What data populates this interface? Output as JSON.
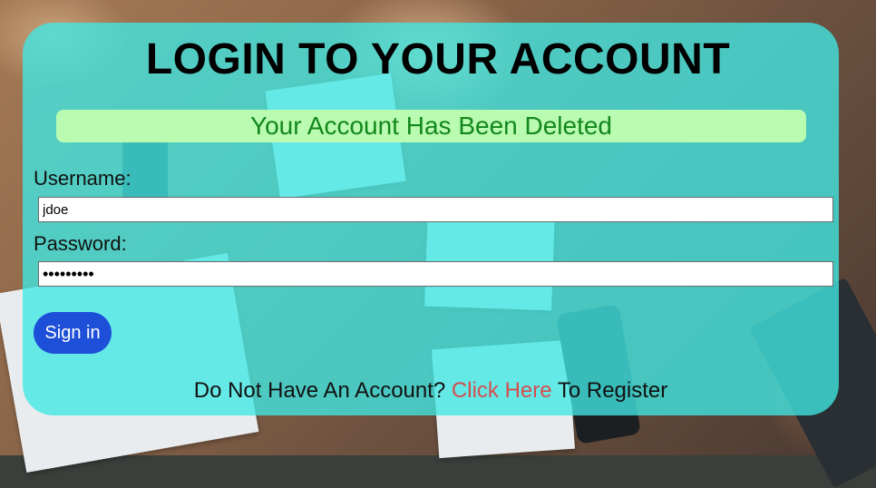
{
  "page": {
    "title": "LOGIN TO YOUR ACCOUNT"
  },
  "alert": {
    "message": "Your Account Has Been Deleted",
    "text_color": "#12871c",
    "background": "#b9fbb0"
  },
  "form": {
    "username_label": "Username:",
    "username_value": "jdoe",
    "password_label": "Password:",
    "password_value": "•••••••••",
    "submit_label": "Sign in"
  },
  "register": {
    "prefix": "Do Not Have An Account?",
    "link_text": "Click Here",
    "suffix": "To Register"
  },
  "colors": {
    "card": "#40e8e4",
    "button": "#1d4fd8",
    "link": "#d44e4e"
  }
}
